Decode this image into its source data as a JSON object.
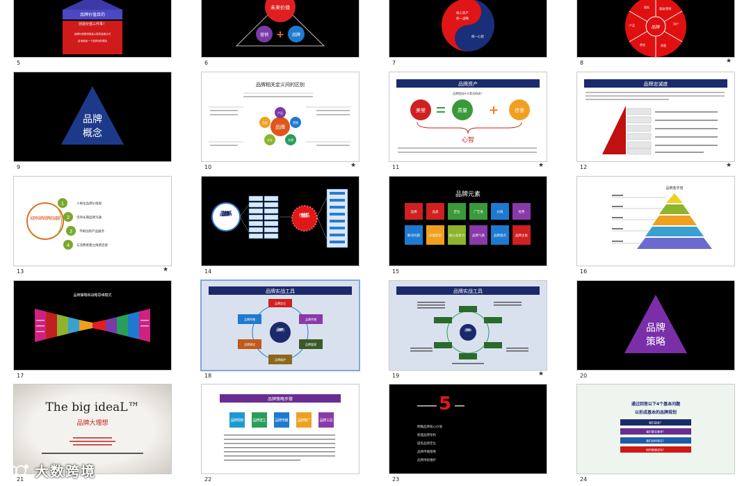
{
  "slides": [
    {
      "n": "5",
      "star": false,
      "t1": "品牌价值目的",
      "t2": "创造价值三件事！",
      "t3": "品牌价值是消费者心智的高度认可",
      "t4": "给消费者一个选择你的理由"
    },
    {
      "n": "6",
      "star": false,
      "t1": "未来价值",
      "t2": "营销",
      "t3": "品牌"
    },
    {
      "n": "7",
      "star": false,
      "t1": "核心资产",
      "t2": "统一战略",
      "t3": "统一心智"
    },
    {
      "n": "8",
      "star": true,
      "center": "品牌",
      "s1": "服务",
      "s2": "渠道/营销",
      "s3": "用户",
      "s4": "产品",
      "s5": "质量",
      "s6": "视觉"
    },
    {
      "n": "9",
      "star": false,
      "t1": "品牌",
      "t2": "概念"
    },
    {
      "n": "10",
      "star": true,
      "title": "品牌相关定义间的区别",
      "center": "品牌",
      "n1": "产品",
      "n2": "营销",
      "n3": "名牌",
      "n4": "文化",
      "n5": "品质"
    },
    {
      "n": "11",
      "star": true,
      "title": "品牌资产",
      "sub": "品牌是由什么等式构成？",
      "a": "美誉",
      "b": "质量",
      "c": "信誉",
      "mind": "心智"
    },
    {
      "n": "12",
      "star": true,
      "title": "品牌忠诚度"
    },
    {
      "n": "13",
      "star": true,
      "circle": "如何培养品牌忠诚度",
      "items": [
        "人格化品牌价值观",
        "坚持长期品牌沟通",
        "不断创新产品服务",
        "与消费者建立情感连接"
      ]
    },
    {
      "n": "14",
      "star": false,
      "left": "品牌体系",
      "mid": "传播体系"
    },
    {
      "n": "15",
      "star": false,
      "title": "品牌元素",
      "row1": [
        "品牌",
        "品类",
        "定位",
        "广告语",
        "价值",
        "优势"
      ],
      "row2": [
        "解决问题",
        "价值定位",
        "核心竞争力",
        "品牌气质",
        "品牌观点",
        "品牌主张"
      ]
    },
    {
      "n": "16",
      "star": false,
      "title": "品牌金字塔"
    },
    {
      "n": "17",
      "star": false,
      "title": "品牌策略和战略思维模式"
    },
    {
      "n": "18",
      "star": false,
      "title": "品牌实战工具",
      "center": "品牌架构",
      "b1": "品牌定位",
      "b2": "品牌传播",
      "b3": "品牌管理",
      "b4": "品牌维护",
      "b5": "品牌建设",
      "b6": "品牌传播"
    },
    {
      "n": "19",
      "star": true,
      "title": "品牌实战工具",
      "center": "品牌架构"
    },
    {
      "n": "20",
      "star": false,
      "t1": "品牌",
      "t2": "策略"
    },
    {
      "n": "21",
      "star": false,
      "logo": "The big ideaL™",
      "sub": "品牌大理想"
    },
    {
      "n": "22",
      "star": false,
      "title": "品牌策略步骤",
      "steps": [
        "品牌规划",
        "品牌建立",
        "品牌传播",
        "品牌推广",
        "品牌工具"
      ]
    },
    {
      "n": "23",
      "star": false,
      "big": "5",
      "items": [
        "明确品牌核心价值",
        "梳理品牌架构",
        "提炼品牌定位",
        "品牌传播策略",
        "品牌持续维护"
      ]
    },
    {
      "n": "24",
      "star": false,
      "title1": "通过回答以下4个基本问题",
      "title2": "以形成基本的品牌规划",
      "bars": [
        "我们是谁？",
        "我们要去哪里？",
        "我们如何到达？",
        "如何衡量成功？"
      ]
    }
  ],
  "watermark": "大数跨境",
  "colors": {
    "accent": "#e8261c",
    "navy": "#1b2a6b",
    "purple": "#6a2c91"
  }
}
